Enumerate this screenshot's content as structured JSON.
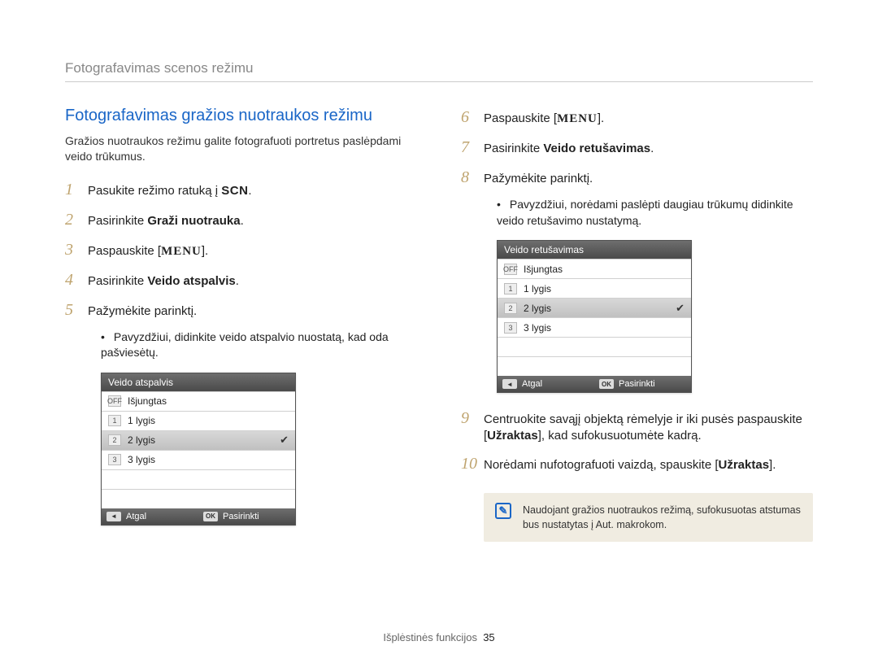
{
  "breadcrumb": "Fotografavimas scenos režimu",
  "section_title": "Fotografavimas gražios nuotraukos režimu",
  "intro": "Gražios nuotraukos režimu galite fotografuoti portretus paslėpdami veido trūkumus.",
  "left_steps": {
    "s1": {
      "num": "1",
      "pre": "Pasukite režimo ratuką į ",
      "kw": "SCN",
      "post": "."
    },
    "s2": {
      "num": "2",
      "pre": "Pasirinkite ",
      "bold": "Graži nuotrauka",
      "post": "."
    },
    "s3": {
      "num": "3",
      "pre": "Paspauskite [",
      "kw": "MENU",
      "post": "]."
    },
    "s4": {
      "num": "4",
      "pre": "Pasirinkite ",
      "bold": "Veido atspalvis",
      "post": "."
    },
    "s5": {
      "num": "5",
      "text": "Pažymėkite parinktį."
    },
    "s5_sub": "Pavyzdžiui, didinkite veido atspalvio nuostatą, kad oda pašviesėtų."
  },
  "right_steps": {
    "s6": {
      "num": "6",
      "pre": "Paspauskite [",
      "kw": "MENU",
      "post": "]."
    },
    "s7": {
      "num": "7",
      "pre": "Pasirinkite ",
      "bold": "Veido retušavimas",
      "post": "."
    },
    "s8": {
      "num": "8",
      "text": "Pažymėkite parinktį."
    },
    "s8_sub": "Pavyzdžiui, norėdami paslėpti daugiau trūkumų didinkite veido retušavimo nustatymą.",
    "s9": {
      "num": "9",
      "pre": "Centruokite savąjį objektą rėmelyje ir iki pusės paspauskite [",
      "bold": "Užraktas",
      "post": "], kad sufokusuotumėte kadrą."
    },
    "s10": {
      "num": "10",
      "pre": "Norėdami nufotografuoti vaizdą, spauskite [",
      "bold": "Užraktas",
      "post": "]."
    }
  },
  "lcd1": {
    "title": "Veido atspalvis",
    "items": [
      {
        "icon": "OFF",
        "label": "Išjungtas"
      },
      {
        "icon": "1",
        "label": "1 lygis"
      },
      {
        "icon": "2",
        "label": "2 lygis",
        "selected": true
      },
      {
        "icon": "3",
        "label": "3 lygis"
      }
    ],
    "back_btn": "◄",
    "back": "Atgal",
    "ok_btn": "OK",
    "ok": "Pasirinkti"
  },
  "lcd2": {
    "title": "Veido retušavimas",
    "items": [
      {
        "icon": "OFF",
        "label": "Išjungtas"
      },
      {
        "icon": "1",
        "label": "1 lygis"
      },
      {
        "icon": "2",
        "label": "2 lygis",
        "selected": true
      },
      {
        "icon": "3",
        "label": "3 lygis"
      }
    ],
    "back_btn": "◄",
    "back": "Atgal",
    "ok_btn": "OK",
    "ok": "Pasirinkti"
  },
  "note": "Naudojant gražios nuotraukos režimą, sufokusuotas atstumas bus nustatytas į Aut. makrokom.",
  "footer": {
    "section": "Išplėstinės funkcijos",
    "page": "35"
  }
}
